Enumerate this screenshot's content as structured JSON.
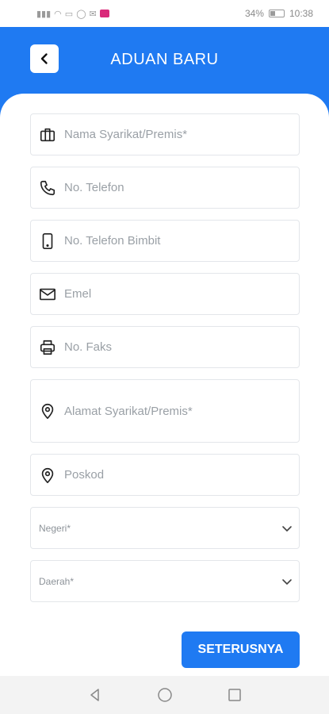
{
  "status_bar": {
    "battery": "34%",
    "time": "10:38"
  },
  "header": {
    "title": "ADUAN BARU",
    "back_icon": "chevron-left-icon"
  },
  "form": {
    "company": {
      "placeholder": "Nama Syarikat/Premis*",
      "icon": "briefcase-icon"
    },
    "phone": {
      "placeholder": "No. Telefon",
      "icon": "phone-icon"
    },
    "mobile": {
      "placeholder": "No. Telefon Bimbit",
      "icon": "mobile-icon"
    },
    "email": {
      "placeholder": "Emel",
      "icon": "mail-icon"
    },
    "fax": {
      "placeholder": "No. Faks",
      "icon": "printer-icon"
    },
    "address": {
      "placeholder": "Alamat Syarikat/Premis*",
      "icon": "location-pin-icon"
    },
    "postcode": {
      "placeholder": "Poskod",
      "icon": "location-pin-icon"
    },
    "state": {
      "placeholder": "Negeri*"
    },
    "district": {
      "placeholder": "Daerah*"
    }
  },
  "actions": {
    "next_label": "SETERUSNYA"
  },
  "colors": {
    "primary": "#1f7af2",
    "field_border": "#e3e6ea",
    "placeholder": "#9aa0a6"
  }
}
